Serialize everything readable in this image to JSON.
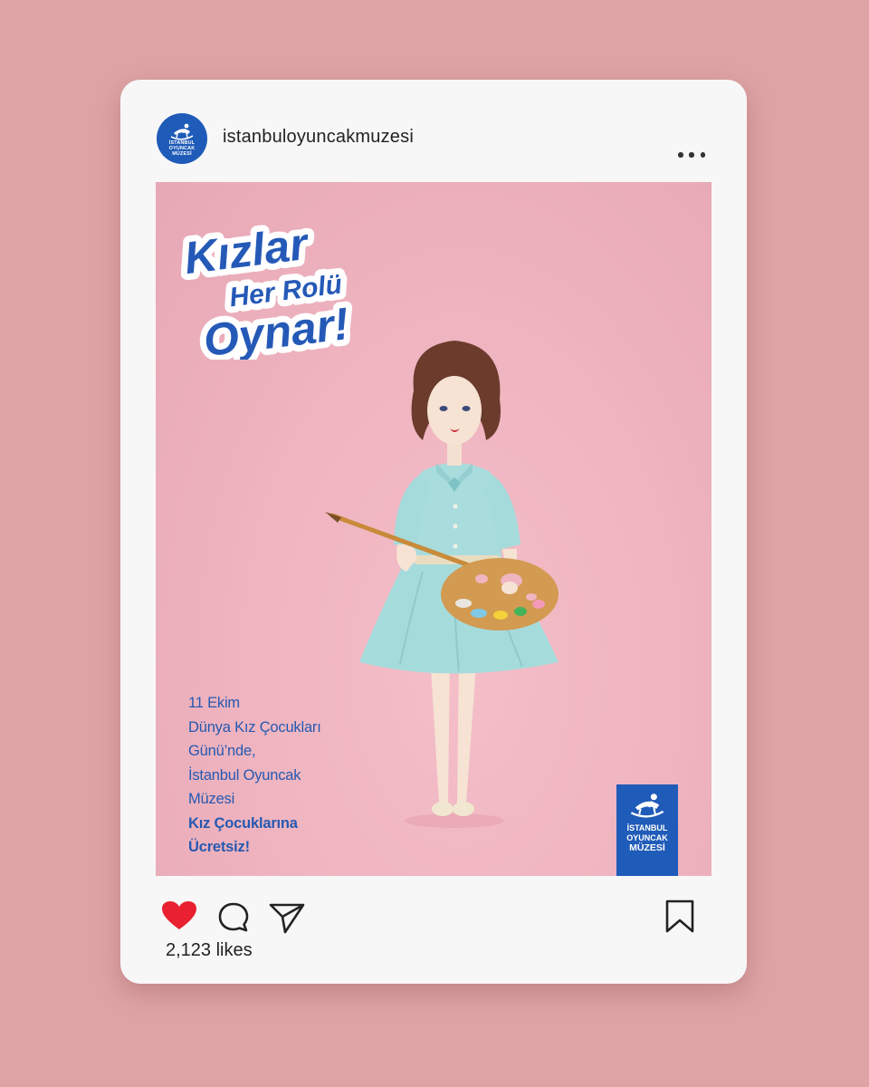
{
  "account": {
    "username": "istanbuloyuncakmuzesi",
    "avatar_label_lines": [
      "İSTANBUL",
      "OYUNCAK",
      "MÜZESİ"
    ]
  },
  "post": {
    "headline_lines": [
      "Kızlar",
      "Her Rolü",
      "Oynar!"
    ],
    "caption_lines": [
      "11 Ekim",
      "Dünya Kız Çocukları",
      "Günü’nde,",
      "İstanbul Oyuncak",
      "Müzesi",
      "Kız Çocuklarına",
      "Ücretsiz!"
    ],
    "logo_lines": [
      "İSTANBUL",
      "OYUNCAK",
      "MÜZESİ"
    ]
  },
  "actions": {
    "like_icon": "heart-icon",
    "comment_icon": "comment-icon",
    "share_icon": "paper-plane-icon",
    "save_icon": "bookmark-icon",
    "liked": true,
    "likes_text": "2,123 likes"
  },
  "colors": {
    "background": "#dea4a5",
    "card": "#f7f7f7",
    "brand_blue": "#1f5bb8",
    "heart_red": "#e8202f",
    "post_pink": "#efb5c0"
  }
}
